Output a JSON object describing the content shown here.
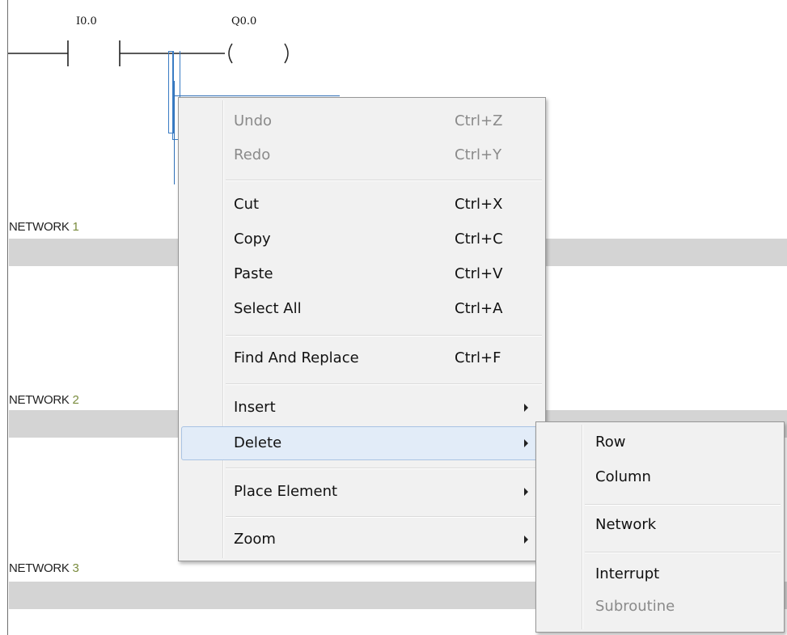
{
  "ladder": {
    "contact_address": "I0.0",
    "coil_address": "Q0.0"
  },
  "networks": [
    {
      "prefix": "NETWORK ",
      "number": "1"
    },
    {
      "prefix": "NETWORK ",
      "number": "2"
    },
    {
      "prefix": "NETWORK ",
      "number": "3"
    }
  ],
  "context_menu": {
    "items": [
      {
        "label": "Undo",
        "shortcut": "Ctrl+Z",
        "enabled": false
      },
      {
        "label": "Redo",
        "shortcut": "Ctrl+Y",
        "enabled": false
      },
      {
        "label": "Cut",
        "shortcut": "Ctrl+X",
        "enabled": true
      },
      {
        "label": "Copy",
        "shortcut": "Ctrl+C",
        "enabled": true
      },
      {
        "label": "Paste",
        "shortcut": "Ctrl+V",
        "enabled": true
      },
      {
        "label": "Select All",
        "shortcut": "Ctrl+A",
        "enabled": true
      },
      {
        "label": "Find And Replace",
        "shortcut": "Ctrl+F",
        "enabled": true
      },
      {
        "label": "Insert",
        "submenu": true,
        "enabled": true
      },
      {
        "label": "Delete",
        "submenu": true,
        "enabled": true,
        "highlighted": true
      },
      {
        "label": "Place Element",
        "submenu": true,
        "enabled": true
      },
      {
        "label": "Zoom",
        "submenu": true,
        "enabled": true
      }
    ]
  },
  "delete_submenu": {
    "items": [
      {
        "label": "Row",
        "enabled": true
      },
      {
        "label": "Column",
        "enabled": true
      },
      {
        "label": "Network",
        "enabled": true
      },
      {
        "label": "Interrupt",
        "enabled": true
      },
      {
        "label": "Subroutine",
        "enabled": false
      }
    ]
  },
  "colors": {
    "highlight_bg": "#e2ecf8",
    "network_bar": "#d4d4d4",
    "network_number": "#7a8c3e",
    "selection": "#2e6fb7"
  }
}
